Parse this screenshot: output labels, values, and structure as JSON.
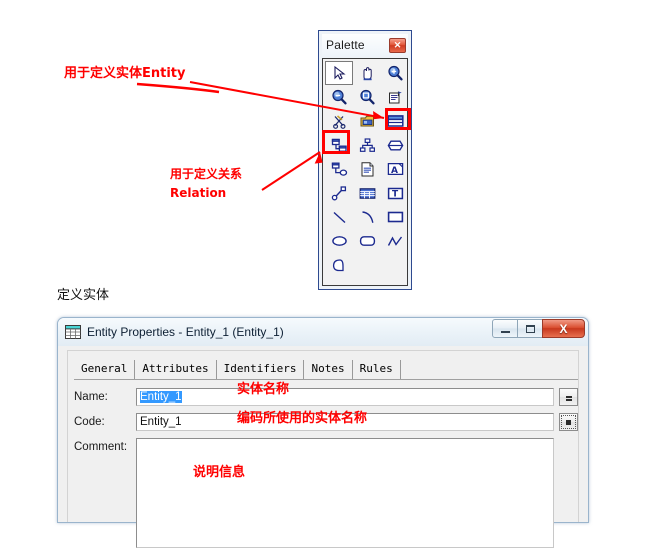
{
  "palette": {
    "title": "Palette",
    "close_label": "✕",
    "tools": [
      {
        "name": "pointer-tool",
        "row": 1,
        "col": 1,
        "selected": true
      },
      {
        "name": "pan-hand-tool",
        "row": 1,
        "col": 2,
        "selected": false
      },
      {
        "name": "zoom-in-tool",
        "row": 1,
        "col": 3,
        "selected": false
      },
      {
        "name": "zoom-out-tool",
        "row": 2,
        "col": 1,
        "selected": false
      },
      {
        "name": "zoom-area-tool",
        "row": 2,
        "col": 2,
        "selected": false
      },
      {
        "name": "properties-tool",
        "row": 2,
        "col": 3,
        "selected": false
      },
      {
        "name": "delete-scissors-tool",
        "row": 3,
        "col": 1,
        "selected": false
      },
      {
        "name": "package-tool",
        "row": 3,
        "col": 2,
        "selected": false
      },
      {
        "name": "entity-tool",
        "row": 3,
        "col": 3,
        "selected": false
      },
      {
        "name": "relationship-tool",
        "row": 4,
        "col": 1,
        "selected": false
      },
      {
        "name": "inheritance-tool",
        "row": 4,
        "col": 2,
        "selected": false
      },
      {
        "name": "association-tool",
        "row": 4,
        "col": 3,
        "selected": false
      },
      {
        "name": "link-tool",
        "row": 5,
        "col": 1,
        "selected": false
      },
      {
        "name": "file-note-tool",
        "row": 5,
        "col": 2,
        "selected": false
      },
      {
        "name": "title-area-tool",
        "row": 5,
        "col": 3,
        "selected": false
      },
      {
        "name": "dependency-tool",
        "row": 6,
        "col": 1,
        "selected": false
      },
      {
        "name": "table-tool",
        "row": 6,
        "col": 2,
        "selected": false
      },
      {
        "name": "text-tool",
        "row": 6,
        "col": 3,
        "selected": false
      },
      {
        "name": "line-tool",
        "row": 7,
        "col": 1,
        "selected": false
      },
      {
        "name": "arc-tool",
        "row": 7,
        "col": 2,
        "selected": false
      },
      {
        "name": "rectangle-tool",
        "row": 7,
        "col": 3,
        "selected": false
      },
      {
        "name": "ellipse-tool",
        "row": 8,
        "col": 1,
        "selected": false
      },
      {
        "name": "rounded-rect-tool",
        "row": 8,
        "col": 2,
        "selected": false
      },
      {
        "name": "polyline-tool",
        "row": 8,
        "col": 3,
        "selected": false
      },
      {
        "name": "polygon-tool",
        "row": 9,
        "col": 1,
        "selected": false
      }
    ],
    "highlight_color": "#ff0000"
  },
  "annotations": {
    "entity": "用于定义实体Entity",
    "relation_line1": "用于定义关系",
    "relation_line2": "Relation",
    "name_field": "实体名称",
    "code_field": "编码所使用的实体名称",
    "comment_field": "说明信息",
    "color": "#ff0000"
  },
  "caption": {
    "define_entity": "定义实体"
  },
  "dialog": {
    "title": "Entity Properties - Entity_1 (Entity_1)",
    "window_controls": {
      "minimize": "",
      "maximize": "",
      "close": "X"
    },
    "tabs": [
      {
        "label": "General",
        "active": true
      },
      {
        "label": "Attributes",
        "active": false
      },
      {
        "label": "Identifiers",
        "active": false
      },
      {
        "label": "Notes",
        "active": false
      },
      {
        "label": "Rules",
        "active": false
      }
    ],
    "fields": {
      "name": {
        "label": "Name:",
        "value": "Entity_1",
        "selected": true,
        "button": "="
      },
      "code": {
        "label": "Code:",
        "value": "Entity_1",
        "selected": false,
        "button": "="
      },
      "comment": {
        "label": "Comment:",
        "value": ""
      }
    }
  }
}
